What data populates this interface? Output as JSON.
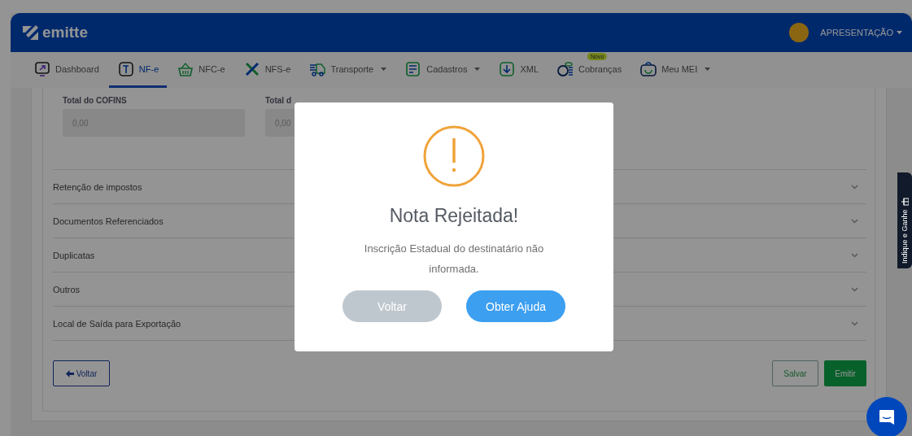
{
  "header": {
    "logo": "emitte",
    "user": "APRESENTAÇÃO"
  },
  "nav": [
    {
      "label": "Dashboard",
      "selected": false,
      "dropdown": false
    },
    {
      "label": "NF-e",
      "selected": true,
      "dropdown": false
    },
    {
      "label": "NFC-e",
      "selected": false,
      "dropdown": false
    },
    {
      "label": "NFS-e",
      "selected": false,
      "dropdown": false
    },
    {
      "label": "Transporte",
      "selected": false,
      "dropdown": true
    },
    {
      "label": "Cadastros",
      "selected": false,
      "dropdown": true
    },
    {
      "label": "XML",
      "selected": false,
      "dropdown": false
    },
    {
      "label": "Cobranças",
      "selected": false,
      "dropdown": false,
      "badge": "Novo"
    },
    {
      "label": "Meu MEI",
      "selected": false,
      "dropdown": true
    }
  ],
  "fields": [
    {
      "label": "Total do COFINS",
      "value": "0,00"
    },
    {
      "label": "Total d",
      "value": "0,00"
    }
  ],
  "sections": [
    {
      "title": "Retenção de impostos",
      "expanded": false
    },
    {
      "title": "Documentos Referenciados",
      "expanded": false
    },
    {
      "title": "Duplicatas",
      "expanded": false
    },
    {
      "title": "Outros",
      "expanded": false
    },
    {
      "title": "Local de Saída para Exportação",
      "expanded": false
    }
  ],
  "back_button": "Voltar",
  "save_button": "Salvar",
  "emit_button": "Emitir",
  "side_tab": "Indique e Ganhe",
  "modal": {
    "title": "Nota Rejeitada!",
    "message": "Inscrição Estadual do destinatário não informada.",
    "buttons": [
      {
        "label": "Voltar",
        "kind": "secondary"
      },
      {
        "label": "Obter Ajuda",
        "kind": "primary"
      }
    ]
  }
}
